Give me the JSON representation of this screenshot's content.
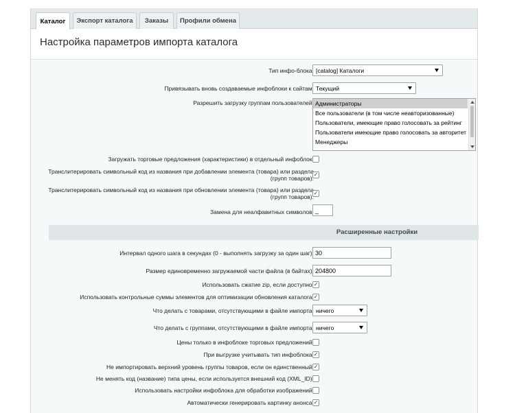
{
  "tabs": [
    {
      "label": "Каталог",
      "active": true
    },
    {
      "label": "Экспорт каталога",
      "active": false
    },
    {
      "label": "Заказы",
      "active": false
    },
    {
      "label": "Профили обмена",
      "active": false
    }
  ],
  "page_title": "Настройка параметров импорта каталога",
  "form": {
    "iblock_type": {
      "label": "Тип инфо-блока:",
      "value": "[catalog] Каталоги"
    },
    "bind_sites": {
      "label": "Привязывать вновь создаваемые инфоблоки к сайтам:",
      "value": "Текущий"
    },
    "allow_groups": {
      "label": "Разрешить загрузку группам пользователей:",
      "options": [
        "Администраторы",
        "Все пользователи (в том числе неавторизованные)",
        "Пользователи, имеющие право голосовать за рейтинг",
        "Пользователи имеющие право голосовать за авторитет",
        "Менеджеры"
      ],
      "selected_index": 0
    },
    "offers_separate": {
      "label": "Загружать торговые предложения (характеристики) в отдельный инфоблок:",
      "checked": false
    },
    "translit_add": {
      "label_line1": "Транслитерировать символьный код из названия при добавлении элемента (товара) или раздела",
      "label_line2": "(групп товаров):",
      "checked": true
    },
    "translit_update": {
      "label_line1": "Транслитерировать символьный код из названия при обновлении элемента (товара) или раздела",
      "label_line2": "(групп товаров):",
      "checked": true
    },
    "replace_char": {
      "label": "Замена для неалфавитных символов:",
      "value": "_"
    }
  },
  "advanced": {
    "section_title": "Расширенные настройки",
    "interval": {
      "label": "Интервал одного шага в секундах (0 - выполнять загрузку за один шаг):",
      "value": "30"
    },
    "file_part_size": {
      "label": "Размер единовременно загружаемой части файла (в байтах):",
      "value": "204800"
    },
    "use_zip": {
      "label": "Использовать сжатие zip, если доступно:",
      "checked": true
    },
    "use_crc": {
      "label": "Использовать контрольные суммы элементов для оптимизации обновления каталога:",
      "checked": true
    },
    "missing_products": {
      "label": "Что делать с товарами, отсутствующими в файле импорта:",
      "value": "ничего"
    },
    "missing_groups": {
      "label": "Что делать с группами, отсутствующими в файле импорта:",
      "value": "ничего"
    },
    "prices_only_offers": {
      "label": "Цены только в инфоблоке торговых предложений:",
      "checked": false
    },
    "account_iblock_type": {
      "label": "При выгрузке учитывать тип инфоблока:",
      "checked": true
    },
    "skip_top_level": {
      "label": "Не импортировать верхний уровень группы товаров, если он единственный:",
      "checked": true
    },
    "keep_price_code": {
      "label": "Не менять код (название) типа цены, если используется внешний код (XML_ID):",
      "checked": false
    },
    "use_iblock_img": {
      "label": "Использовать настройки инфоблока для обработки изображений:",
      "checked": false
    },
    "auto_preview": {
      "label": "Автоматически генерировать картинку анонса:",
      "checked": true
    }
  }
}
